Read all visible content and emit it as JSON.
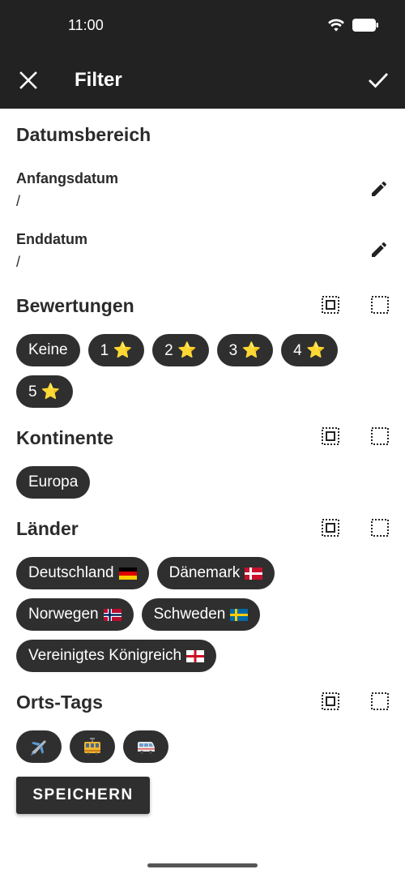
{
  "status_bar": {
    "time": "11:00"
  },
  "app_bar": {
    "title": "Filter"
  },
  "date_range": {
    "title": "Datumsbereich",
    "start_label": "Anfangsdatum",
    "start_value": "/",
    "end_label": "Enddatum",
    "end_value": "/"
  },
  "ratings": {
    "title": "Bewertungen",
    "chips": [
      "Keine",
      "1 ⭐",
      "2 ⭐",
      "3 ⭐",
      "4 ⭐",
      "5 ⭐"
    ]
  },
  "continents": {
    "title": "Kontinente",
    "chips": [
      "Europa"
    ]
  },
  "countries": {
    "title": "Länder",
    "chips": [
      "Deutschland",
      "Dänemark",
      "Norwegen",
      "Schweden",
      "Vereinigtes Königreich"
    ]
  },
  "place_tags": {
    "title": "Orts-Tags",
    "chips": [
      "airplane-icon",
      "tram-icon",
      "minibus-icon"
    ]
  },
  "save_button": {
    "label": "SPEICHERN"
  },
  "colors": {
    "bar": "#222222",
    "chip": "#2f2f2f",
    "background": "#ffffff"
  }
}
